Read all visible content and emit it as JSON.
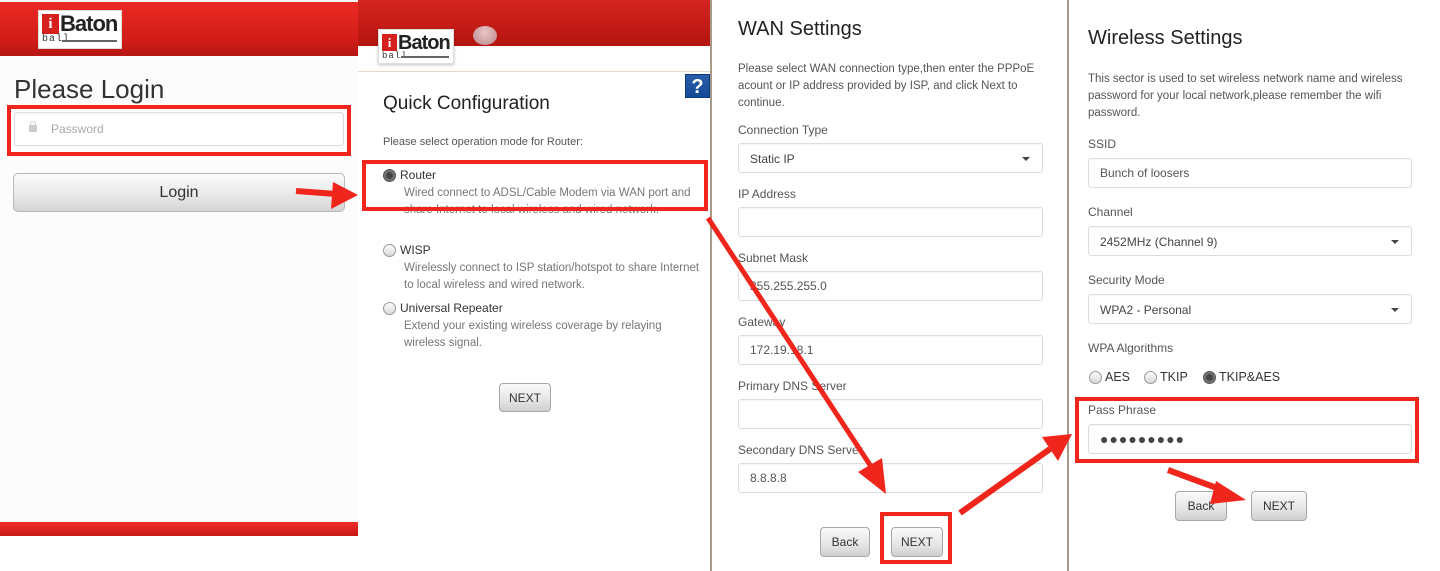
{
  "brand": {
    "logo_i": "i",
    "logo_name": "Baton",
    "logo_sub": "ball",
    "header_color": "#d21d18",
    "annotation_color": "#f0261c"
  },
  "login": {
    "title": "Please Login",
    "password_placeholder": "Password",
    "password_value": "",
    "login_label": "Login"
  },
  "quick_config": {
    "help_label": "?",
    "title": "Quick Configuration",
    "prompt": "Please select operation mode for Router:",
    "modes": [
      {
        "label": "Router",
        "description": "Wired connect to ADSL/Cable Modem via WAN port and share Internet to local wireless and wired network.",
        "selected": true
      },
      {
        "label": "WISP",
        "description": "Wirelessly connect to ISP station/hotspot to share Internet to local wireless and wired network.",
        "selected": false
      },
      {
        "label": "Universal Repeater",
        "description": "Extend your existing wireless coverage by relaying wireless signal.",
        "selected": false
      }
    ],
    "next_label": "NEXT"
  },
  "wan": {
    "title": "WAN Settings",
    "description": "Please select WAN connection type,then enter the PPPoE acount or IP address provided by ISP, and click Next to continue.",
    "connection_type_label": "Connection Type",
    "connection_type_value": "Static IP",
    "ip_address_label": "IP Address",
    "ip_address_value": "",
    "subnet_mask_label": "Subnet Mask",
    "subnet_mask_value": "255.255.255.0",
    "gateway_label": "Gateway",
    "gateway_value": "172.19.18.1",
    "primary_dns_label": "Primary DNS Server",
    "primary_dns_value": "",
    "secondary_dns_label": "Secondary DNS Server",
    "secondary_dns_value": "8.8.8.8",
    "back_label": "Back",
    "next_label": "NEXT"
  },
  "wireless": {
    "title": "Wireless Settings",
    "description": "This sector is used to set wireless network name and wireless password for your local network,please remember the wifi password.",
    "ssid_label": "SSID",
    "ssid_value": "Bunch of loosers",
    "channel_label": "Channel",
    "channel_value": "2452MHz (Channel 9)",
    "security_mode_label": "Security Mode",
    "security_mode_value": "WPA2 - Personal",
    "wpa_algorithms_label": "WPA Algorithms",
    "algorithms": [
      {
        "label": "AES",
        "selected": false
      },
      {
        "label": "TKIP",
        "selected": false
      },
      {
        "label": "TKIP&AES",
        "selected": true
      }
    ],
    "pass_phrase_label": "Pass Phrase",
    "pass_phrase_value": "●●●●●●●●●",
    "back_label": "Back",
    "next_label": "NEXT"
  }
}
